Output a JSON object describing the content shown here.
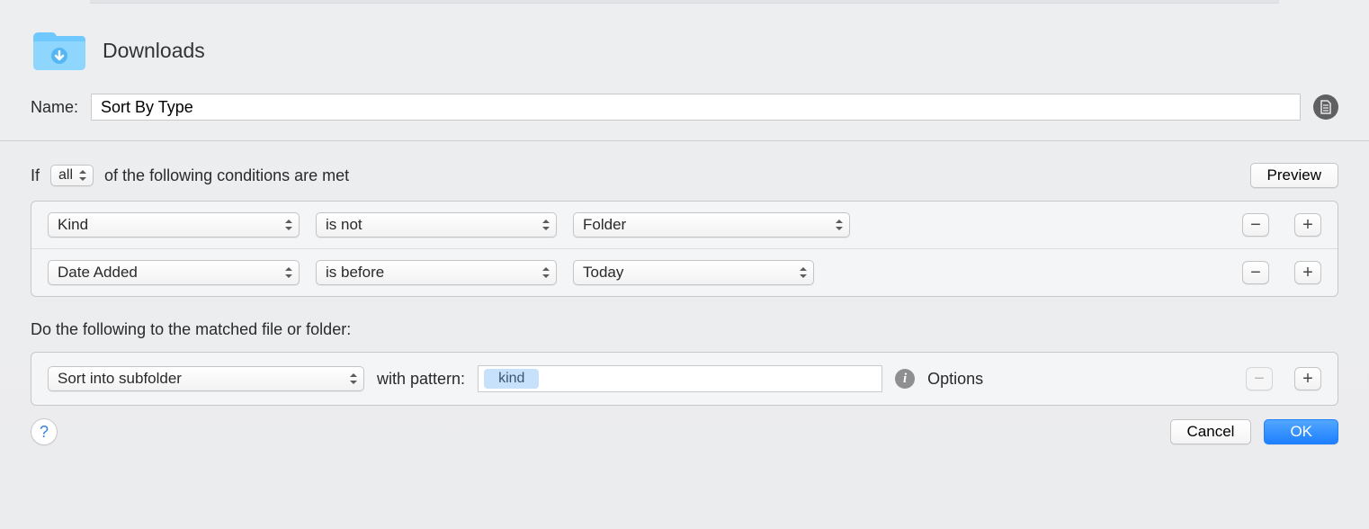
{
  "header": {
    "folder_name": "Downloads"
  },
  "name_row": {
    "label": "Name:",
    "value": "Sort By Type"
  },
  "conditions": {
    "if_prefix": "If",
    "quantifier": "all",
    "suffix": "of the following conditions are met",
    "preview_label": "Preview",
    "rows": [
      {
        "attr": "Kind",
        "op": "is not",
        "value": "Folder"
      },
      {
        "attr": "Date Added",
        "op": "is before",
        "value": "Today"
      }
    ]
  },
  "actions": {
    "intro": "Do the following to the matched file or folder:",
    "action": "Sort into subfolder",
    "pattern_label": "with pattern:",
    "pattern_tokens": [
      "kind"
    ],
    "options_label": "Options"
  },
  "footer": {
    "cancel": "Cancel",
    "ok": "OK"
  },
  "glyphs": {
    "minus": "−",
    "plus": "+"
  }
}
